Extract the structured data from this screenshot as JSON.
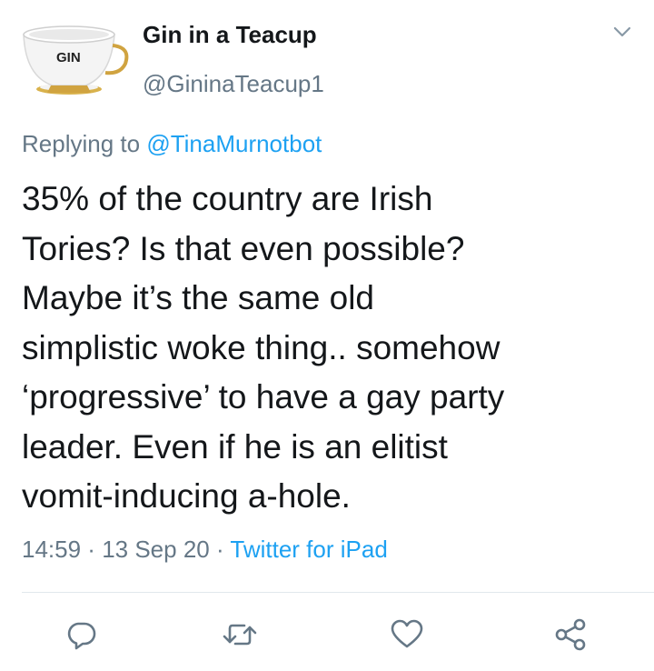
{
  "author": {
    "avatar_text": "GIN",
    "display_name": "Gin in a Teacup",
    "handle": "@GininaTeacup1"
  },
  "reply": {
    "prefix": "Replying to ",
    "mention": "@TinaMurnotbot"
  },
  "tweet": {
    "text": "35% of the country are Irish\nTories? Is that even possible?\nMaybe it’s the same old\nsimplistic woke thing.. somehow\n‘progressive’ to have a gay party\nleader. Even if he is an elitist\nvomit-inducing a-hole."
  },
  "meta": {
    "time": "14:59",
    "sep1": " · ",
    "date": "13 Sep 20",
    "sep2": " · ",
    "source": "Twitter for iPad"
  },
  "icons": {
    "chevron": "chevron-down-icon",
    "reply": "reply-icon",
    "retweet": "retweet-icon",
    "like": "heart-icon",
    "share": "share-icon"
  },
  "colors": {
    "text": "#14171a",
    "secondary": "#657786",
    "link": "#1da1f2",
    "divider": "#e1e8ed"
  }
}
